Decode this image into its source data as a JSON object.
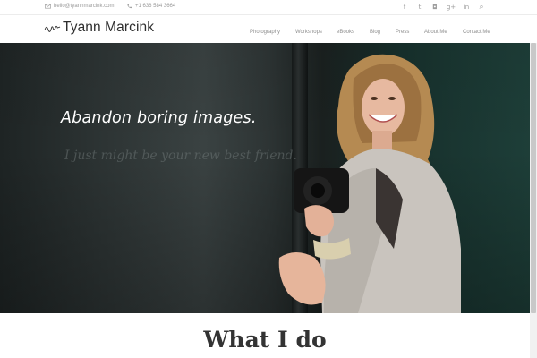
{
  "topbar": {
    "email": "hello@tyannmarcink.com",
    "phone": "+1 636 584 3664",
    "social": [
      {
        "name": "facebook-icon",
        "glyph": "f"
      },
      {
        "name": "twitter-icon",
        "glyph": "t"
      },
      {
        "name": "instagram-icon",
        "glyph": "◘"
      },
      {
        "name": "google-plus-icon",
        "glyph": "g+"
      },
      {
        "name": "linkedin-icon",
        "glyph": "in"
      },
      {
        "name": "search-icon",
        "glyph": "⌕"
      }
    ]
  },
  "header": {
    "logo_text": "Tyann Marcink",
    "nav": [
      "Photography",
      "Workshops",
      "eBooks",
      "Blog",
      "Press",
      "About Me",
      "Contact Me"
    ]
  },
  "hero": {
    "tagline": "Abandon boring images.",
    "subtagline": "I just might be your new best friend."
  },
  "section": {
    "title": "What I do"
  },
  "colors": {
    "hero_dark": "#1e2424",
    "hero_teal": "#1e3f39",
    "heading": "#333333",
    "nav_text": "#8e8e8e"
  }
}
